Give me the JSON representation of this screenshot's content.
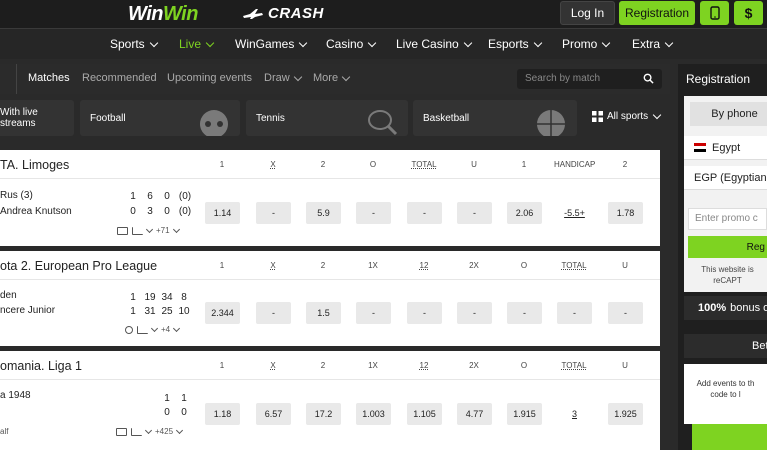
{
  "header": {
    "logo_win1": "Win",
    "logo_win2": "Win",
    "crash_label": "CRASH",
    "login_label": "Log In",
    "register_label": "Registration",
    "dollar_label": "$"
  },
  "nav": [
    {
      "label": "Sports",
      "active": false
    },
    {
      "label": "Live",
      "active": true
    },
    {
      "label": "WinGames",
      "active": false
    },
    {
      "label": "Casino",
      "active": false
    },
    {
      "label": "Live Casino",
      "active": false
    },
    {
      "label": "Esports",
      "active": false
    },
    {
      "label": "Promo",
      "active": false
    },
    {
      "label": "Extra",
      "active": false
    }
  ],
  "tabs": {
    "matches": "Matches",
    "recommended": "Recommended",
    "upcoming": "Upcoming events",
    "draw": "Draw",
    "more": "More",
    "search_placeholder": "Search by match"
  },
  "sports": {
    "live_streams": "With live streams",
    "football": "Football",
    "tennis": "Tennis",
    "basketball": "Basketball",
    "all_sports": "All sports"
  },
  "events": [
    {
      "title": "TA. Limoges",
      "columns": [
        "1",
        "X",
        "2",
        "O",
        "TOTAL",
        "U",
        "1",
        "HANDICAP",
        "2"
      ],
      "players": [
        "Rus (3)",
        "Andrea Knutson"
      ],
      "scores": [
        [
          "1",
          "6",
          "0",
          "(0)"
        ],
        [
          "0",
          "3",
          "0",
          "(0)"
        ]
      ],
      "odds": [
        "1.14",
        "-",
        "5.9",
        "-",
        "-",
        "-",
        "2.06",
        "-5.5+",
        "1.78"
      ],
      "more": "+71"
    },
    {
      "title": "ota 2. European Pro League",
      "columns": [
        "1",
        "X",
        "2",
        "1X",
        "12",
        "2X",
        "O",
        "TOTAL",
        "U"
      ],
      "players": [
        "den",
        "ncere Junior"
      ],
      "scores": [
        [
          "1",
          "19",
          "34",
          "8"
        ],
        [
          "1",
          "31",
          "25",
          "10"
        ]
      ],
      "odds": [
        "2.344",
        "-",
        "1.5",
        "-",
        "-",
        "-",
        "-",
        "-",
        "-"
      ],
      "more": "+4"
    },
    {
      "title": "omania. Liga 1",
      "columns": [
        "1",
        "X",
        "2",
        "1X",
        "12",
        "2X",
        "O",
        "TOTAL",
        "U"
      ],
      "players": [
        "a 1948",
        ""
      ],
      "scores": [
        [
          "1",
          "1"
        ],
        [
          "0",
          "0"
        ]
      ],
      "odds": [
        "1.18",
        "6.57",
        "17.2",
        "1.003",
        "1.105",
        "4.77",
        "1.915",
        "3",
        "1.925"
      ],
      "more": "+425",
      "status": "alf"
    }
  ],
  "sidebar": {
    "title": "Registration",
    "by_phone": "By phone",
    "country": "Egypt",
    "currency": "EGP (Egyptian",
    "promo_placeholder": "Enter promo c",
    "register_button": "Reg",
    "note_line1": "This website is",
    "note_line2": "reCAPT",
    "bonus_pct": "100%",
    "bonus_text": "bonus o",
    "bet_label": "Bet",
    "events_line1": "Add events to th",
    "events_line2": "code to l"
  },
  "colors": {
    "accent": "#7ed321",
    "topbar": "#1d1d1d",
    "nav": "#262626"
  }
}
